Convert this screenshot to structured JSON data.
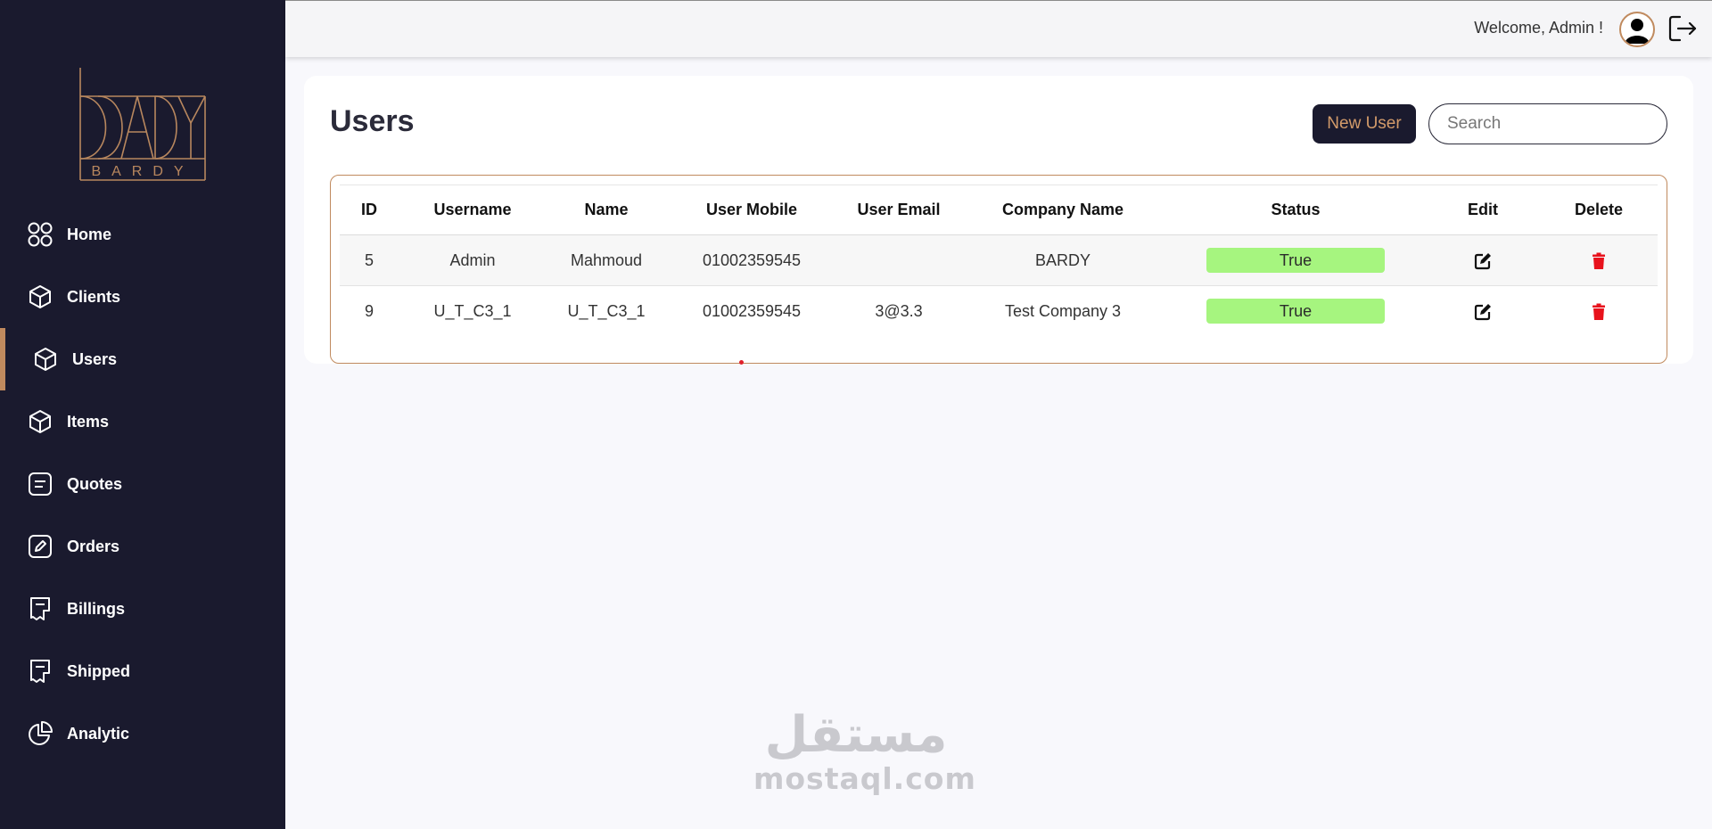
{
  "brand": {
    "logo_text": "BARDY",
    "accent_color": "#c08a5e",
    "sidebar_bg": "#1a1a2e"
  },
  "sidebar": {
    "items": [
      {
        "label": "Home",
        "icon": "grid-icon",
        "active": false
      },
      {
        "label": "Clients",
        "icon": "cube-icon",
        "active": false
      },
      {
        "label": "Users",
        "icon": "cube-icon",
        "active": true
      },
      {
        "label": "Items",
        "icon": "cube-icon",
        "active": false
      },
      {
        "label": "Quotes",
        "icon": "document-lines-icon",
        "active": false
      },
      {
        "label": "Orders",
        "icon": "edit-document-icon",
        "active": false
      },
      {
        "label": "Billings",
        "icon": "receipt-icon",
        "active": false
      },
      {
        "label": "Shipped",
        "icon": "receipt-icon",
        "active": false
      },
      {
        "label": "Analytic",
        "icon": "pie-chart-icon",
        "active": false
      }
    ]
  },
  "header": {
    "welcome": "Welcome, Admin !"
  },
  "main": {
    "title": "Users",
    "new_user_label": "New User",
    "search_placeholder": "Search",
    "table": {
      "columns": [
        "ID",
        "Username",
        "Name",
        "User Mobile",
        "User Email",
        "Company Name",
        "Status",
        "Edit",
        "Delete"
      ],
      "rows": [
        {
          "id": "5",
          "username": "Admin",
          "name": "Mahmoud",
          "mobile": "01002359545",
          "email": "",
          "company": "BARDY",
          "status": "True"
        },
        {
          "id": "9",
          "username": "U_T_C3_1",
          "name": "U_T_C3_1",
          "mobile": "01002359545",
          "email": "3@3.3",
          "company": "Test Company 3",
          "status": "True"
        }
      ],
      "status_color": "#a6f57f",
      "delete_color": "#e8121c"
    }
  },
  "watermark": {
    "arabic": "مستقل",
    "latin": "mostaql.com"
  }
}
